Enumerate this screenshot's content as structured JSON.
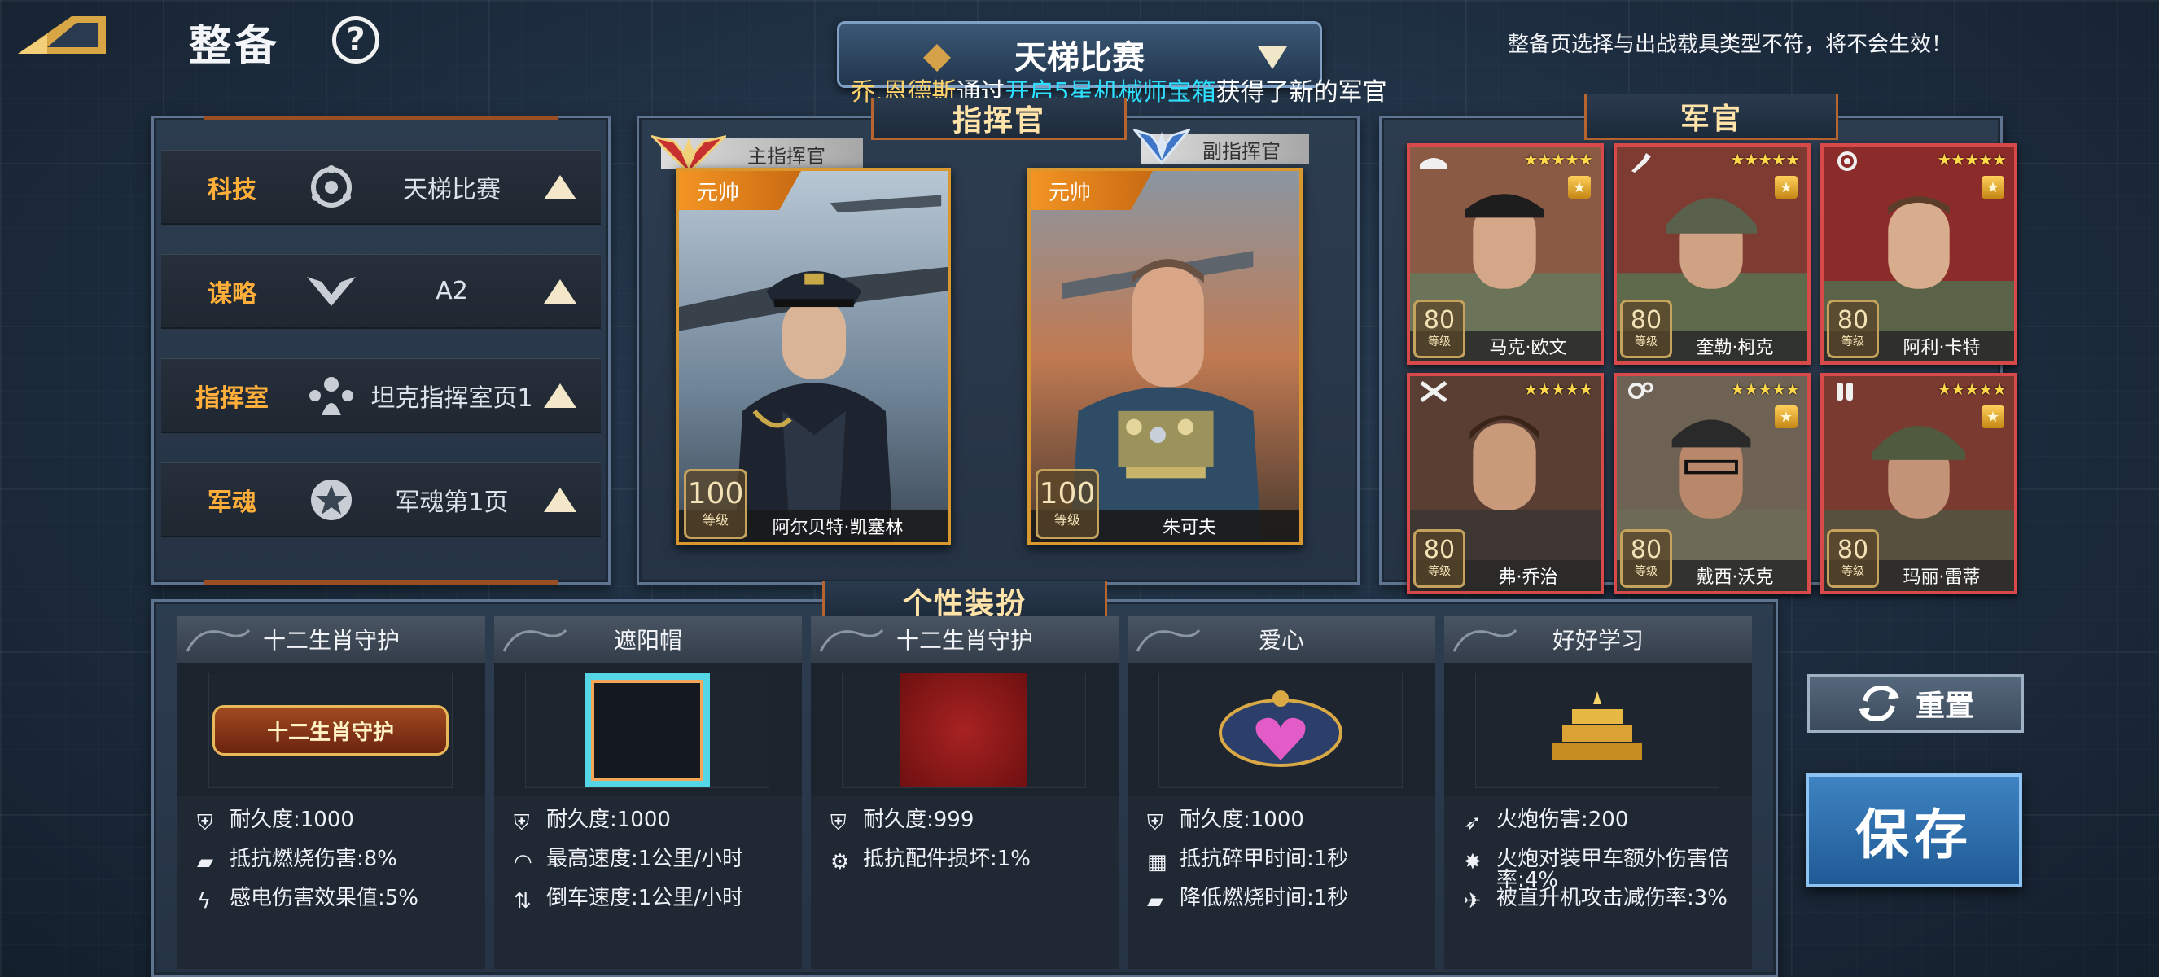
{
  "header": {
    "title": "整备",
    "help_label": "?",
    "mode": "天梯比赛",
    "warning": "整备页选择与出战载具类型不符，将不会生效！"
  },
  "broadcast": {
    "player": "乔.恩德斯",
    "via": "通过",
    "item": "开启5星机械师宝箱",
    "result": "获得了新的军官"
  },
  "config": {
    "rows": [
      {
        "label": "科技",
        "value": "天梯比赛",
        "icon": "gear-icon"
      },
      {
        "label": "谋略",
        "value": "A2",
        "icon": "wings-icon"
      },
      {
        "label": "指挥室",
        "value": "坦克指挥室页1",
        "icon": "command-icon"
      },
      {
        "label": "军魂",
        "value": "军魂第1页",
        "icon": "star-badge-icon"
      }
    ]
  },
  "commander": {
    "tab": "指挥官",
    "main": {
      "role": "主指挥官",
      "rank": "元帅",
      "name": "阿尔贝特·凯塞林",
      "level": "100",
      "level_label": "等级"
    },
    "vice": {
      "role": "副指挥官",
      "rank": "元帅",
      "name": "朱可夫",
      "level": "100",
      "level_label": "等级"
    }
  },
  "officers": {
    "tab": "军官",
    "stars": "★★★★★",
    "medal": "★",
    "level_label": "等级",
    "list": [
      {
        "name": "马克·欧文",
        "level": "80"
      },
      {
        "name": "奎勒·柯克",
        "level": "80"
      },
      {
        "name": "阿利·卡特",
        "level": "80"
      },
      {
        "name": "弗·乔治",
        "level": "80"
      },
      {
        "name": "戴西·沃克",
        "level": "80"
      },
      {
        "name": "玛丽·雷蒂",
        "level": "80"
      }
    ]
  },
  "costume": {
    "tab": "个性装扮",
    "slots": [
      {
        "title": "十二生肖守护",
        "stats": [
          "耐久度:1000",
          "抵抗燃烧伤害:8%",
          "感电伤害效果值:5%"
        ]
      },
      {
        "title": "遮阳帽",
        "stats": [
          "耐久度:1000",
          "最高速度:1公里/小时",
          "倒车速度:1公里/小时"
        ]
      },
      {
        "title": "十二生肖守护",
        "stats": [
          "耐久度:999",
          "抵抗配件损坏:1%"
        ]
      },
      {
        "title": "爱心",
        "stats": [
          "耐久度:1000",
          "抵抗碎甲时间:1秒",
          "降低燃烧时间:1秒"
        ]
      },
      {
        "title": "好好学习",
        "stats": [
          "火炮伤害:200",
          "火炮对装甲车额外伤害倍率:4%",
          "被直升机攻击减伤率:3%"
        ]
      }
    ],
    "thumb_text": "十二生肖守护"
  },
  "actions": {
    "reset": "重置",
    "save": "保存"
  },
  "colors": {
    "accent_orange": "#ffae3a",
    "card_gold": "#d9972f",
    "officer_red": "#d84a4a",
    "save_blue": "#2f6fad"
  }
}
